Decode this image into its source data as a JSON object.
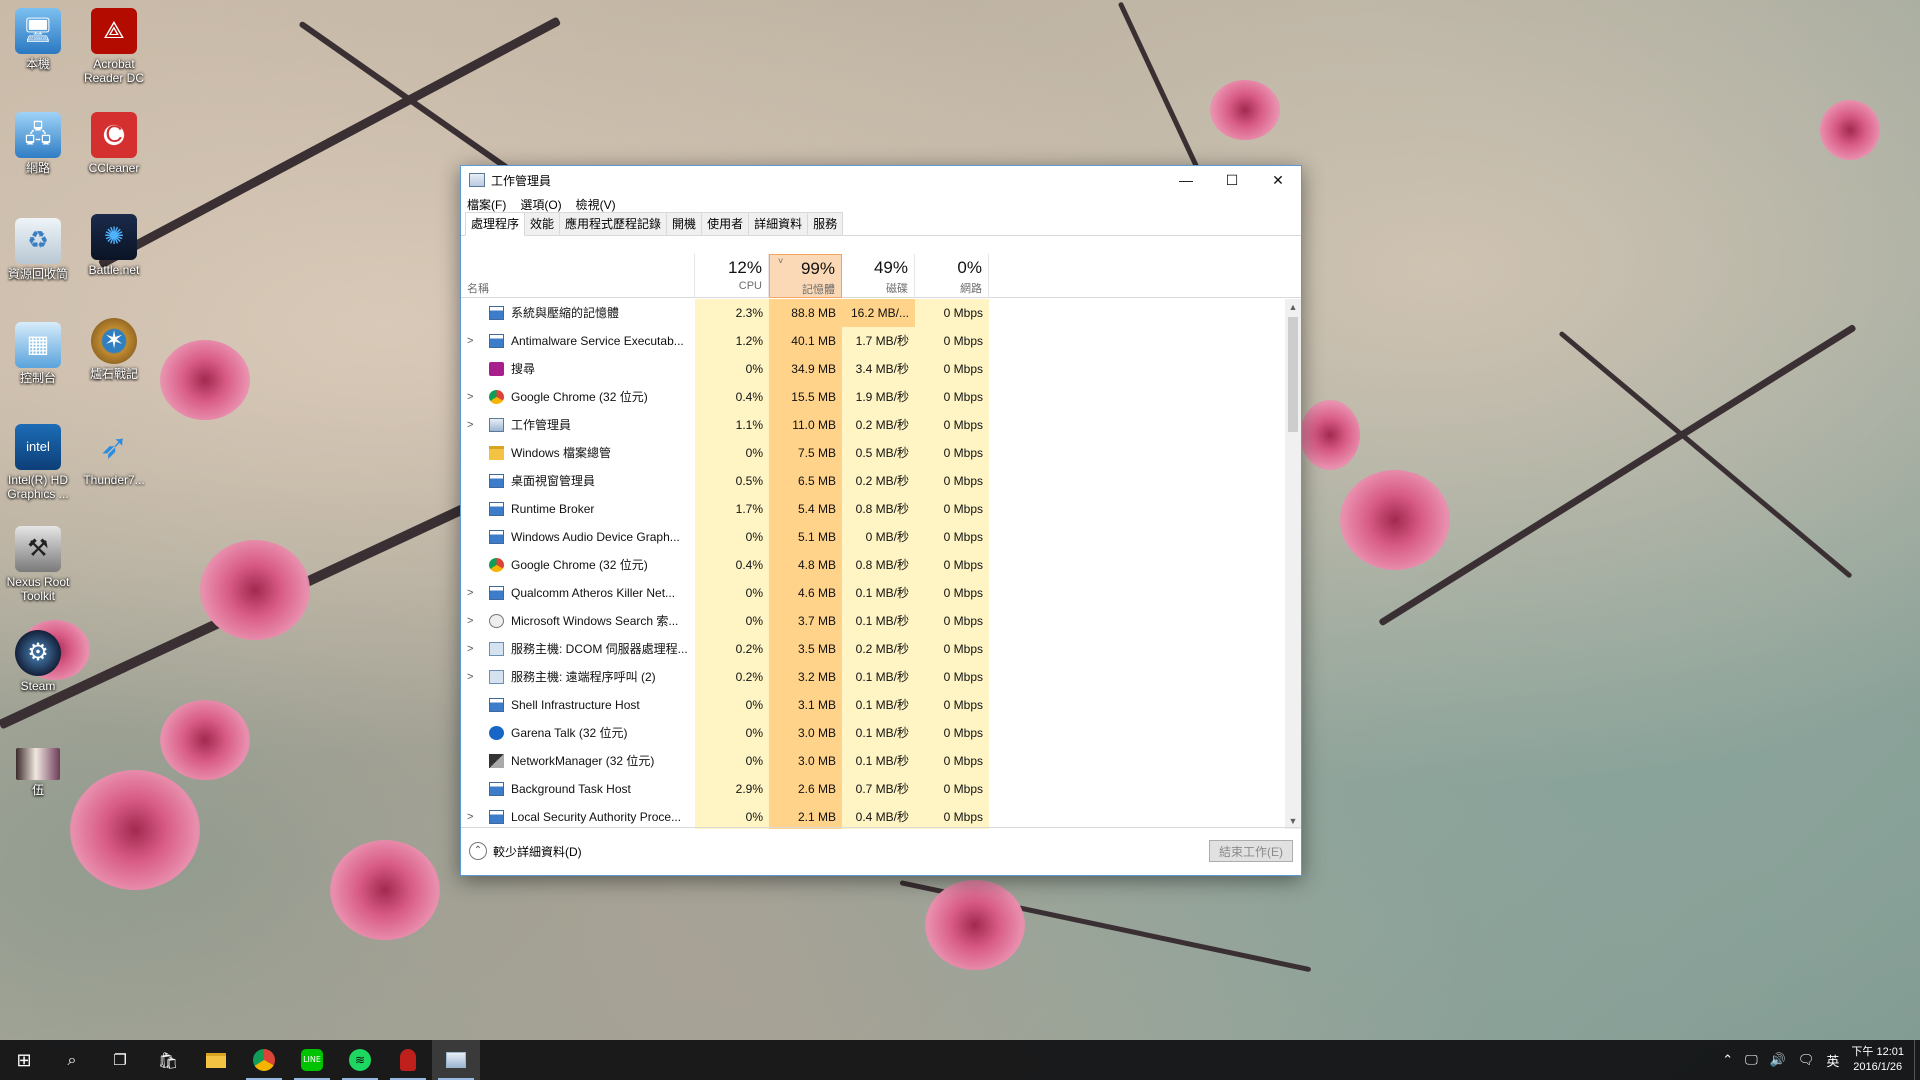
{
  "desktop_icons": [
    {
      "label": "本機",
      "icon": "computer-icon"
    },
    {
      "label": "Acrobat Reader DC",
      "icon": "acrobat-icon"
    },
    {
      "label": "網路",
      "icon": "network-icon"
    },
    {
      "label": "CCleaner",
      "icon": "ccleaner-icon"
    },
    {
      "label": "資源回收筒",
      "icon": "recycle-bin-icon"
    },
    {
      "label": "Battle.net",
      "icon": "battlenet-icon"
    },
    {
      "label": "控制台",
      "icon": "control-panel-icon"
    },
    {
      "label": "爐石戰記",
      "icon": "hearthstone-icon"
    },
    {
      "label": "Intel(R) HD Graphics ...",
      "icon": "intel-graphics-icon"
    },
    {
      "label": "Thunder7...",
      "icon": "thunder-icon"
    },
    {
      "label": "Nexus Root Toolkit",
      "icon": "nexus-toolkit-icon"
    },
    {
      "label": "Steam",
      "icon": "steam-icon"
    },
    {
      "label": "伍",
      "icon": "video-file-icon"
    }
  ],
  "window": {
    "title": "工作管理員",
    "menu": [
      "檔案(F)",
      "選項(O)",
      "檢視(V)"
    ],
    "tabs": [
      "處理程序",
      "效能",
      "應用程式歷程記錄",
      "開機",
      "使用者",
      "詳細資料",
      "服務"
    ],
    "columns": {
      "name": "名稱",
      "cpu": {
        "pct": "12%",
        "label": "CPU"
      },
      "memory": {
        "pct": "99%",
        "label": "記憶體"
      },
      "disk": {
        "pct": "49%",
        "label": "磁碟"
      },
      "network": {
        "pct": "0%",
        "label": "網路"
      }
    },
    "processes": [
      {
        "name": "系統與壓縮的記憶體",
        "expandable": false,
        "icon": "window-icon",
        "cpu": "2.3%",
        "mem": "88.8 MB",
        "disk": "16.2 MB/...",
        "net": "0 Mbps"
      },
      {
        "name": "Antimalware Service Executab...",
        "expandable": true,
        "icon": "window-icon",
        "cpu": "1.2%",
        "mem": "40.1 MB",
        "disk": "1.7 MB/秒",
        "net": "0 Mbps"
      },
      {
        "name": "搜尋",
        "expandable": false,
        "icon": "search-app-icon",
        "cpu": "0%",
        "mem": "34.9 MB",
        "disk": "3.4 MB/秒",
        "net": "0 Mbps"
      },
      {
        "name": "Google Chrome (32 位元)",
        "expandable": true,
        "icon": "chrome-icon",
        "cpu": "0.4%",
        "mem": "15.5 MB",
        "disk": "1.9 MB/秒",
        "net": "0 Mbps"
      },
      {
        "name": "工作管理員",
        "expandable": true,
        "icon": "task-manager-icon",
        "cpu": "1.1%",
        "mem": "11.0 MB",
        "disk": "0.2 MB/秒",
        "net": "0 Mbps"
      },
      {
        "name": "Windows 檔案總管",
        "expandable": false,
        "icon": "folder-icon",
        "cpu": "0%",
        "mem": "7.5 MB",
        "disk": "0.5 MB/秒",
        "net": "0 Mbps"
      },
      {
        "name": "桌面視窗管理員",
        "expandable": false,
        "icon": "window-icon",
        "cpu": "0.5%",
        "mem": "6.5 MB",
        "disk": "0.2 MB/秒",
        "net": "0 Mbps"
      },
      {
        "name": "Runtime Broker",
        "expandable": false,
        "icon": "window-icon",
        "cpu": "1.7%",
        "mem": "5.4 MB",
        "disk": "0.8 MB/秒",
        "net": "0 Mbps"
      },
      {
        "name": "Windows Audio Device Graph...",
        "expandable": false,
        "icon": "window-icon",
        "cpu": "0%",
        "mem": "5.1 MB",
        "disk": "0 MB/秒",
        "net": "0 Mbps"
      },
      {
        "name": "Google Chrome (32 位元)",
        "expandable": false,
        "icon": "chrome-icon",
        "cpu": "0.4%",
        "mem": "4.8 MB",
        "disk": "0.8 MB/秒",
        "net": "0 Mbps"
      },
      {
        "name": "Qualcomm Atheros Killer Net...",
        "expandable": true,
        "icon": "window-icon",
        "cpu": "0%",
        "mem": "4.6 MB",
        "disk": "0.1 MB/秒",
        "net": "0 Mbps"
      },
      {
        "name": "Microsoft Windows Search 索...",
        "expandable": true,
        "icon": "search-indexer-icon",
        "cpu": "0%",
        "mem": "3.7 MB",
        "disk": "0.1 MB/秒",
        "net": "0 Mbps"
      },
      {
        "name": "服務主機: DCOM 伺服器處理程...",
        "expandable": true,
        "icon": "service-host-icon",
        "cpu": "0.2%",
        "mem": "3.5 MB",
        "disk": "0.2 MB/秒",
        "net": "0 Mbps"
      },
      {
        "name": "服務主機: 遠端程序呼叫 (2)",
        "expandable": true,
        "icon": "service-host-icon",
        "cpu": "0.2%",
        "mem": "3.2 MB",
        "disk": "0.1 MB/秒",
        "net": "0 Mbps"
      },
      {
        "name": "Shell Infrastructure Host",
        "expandable": false,
        "icon": "window-icon",
        "cpu": "0%",
        "mem": "3.1 MB",
        "disk": "0.1 MB/秒",
        "net": "0 Mbps"
      },
      {
        "name": "Garena Talk (32 位元)",
        "expandable": false,
        "icon": "garena-icon",
        "cpu": "0%",
        "mem": "3.0 MB",
        "disk": "0.1 MB/秒",
        "net": "0 Mbps"
      },
      {
        "name": "NetworkManager (32 位元)",
        "expandable": false,
        "icon": "network-manager-icon",
        "cpu": "0%",
        "mem": "3.0 MB",
        "disk": "0.1 MB/秒",
        "net": "0 Mbps"
      },
      {
        "name": "Background Task Host",
        "expandable": false,
        "icon": "window-icon",
        "cpu": "2.9%",
        "mem": "2.6 MB",
        "disk": "0.7 MB/秒",
        "net": "0 Mbps"
      },
      {
        "name": "Local Security Authority Proce...",
        "expandable": true,
        "icon": "window-icon",
        "cpu": "0%",
        "mem": "2.1 MB",
        "disk": "0.4 MB/秒",
        "net": "0 Mbps"
      }
    ],
    "footer": {
      "fewer_details": "較少詳細資料(D)",
      "end_task": "結束工作(E)"
    }
  },
  "taskbar": {
    "apps": [
      "start-icon",
      "search-icon",
      "task-view-icon",
      "store-icon",
      "file-explorer-icon",
      "chrome-icon",
      "line-icon",
      "spotify-icon",
      "app-red-icon",
      "task-manager-icon"
    ],
    "tray": {
      "ime": "英",
      "time": "下午 12:01",
      "date": "2016/1/26"
    }
  },
  "colors": {
    "accent": "#5b9bd5",
    "mem_heat": "#ffd38a",
    "cpu_heat": "#fff4c4"
  }
}
